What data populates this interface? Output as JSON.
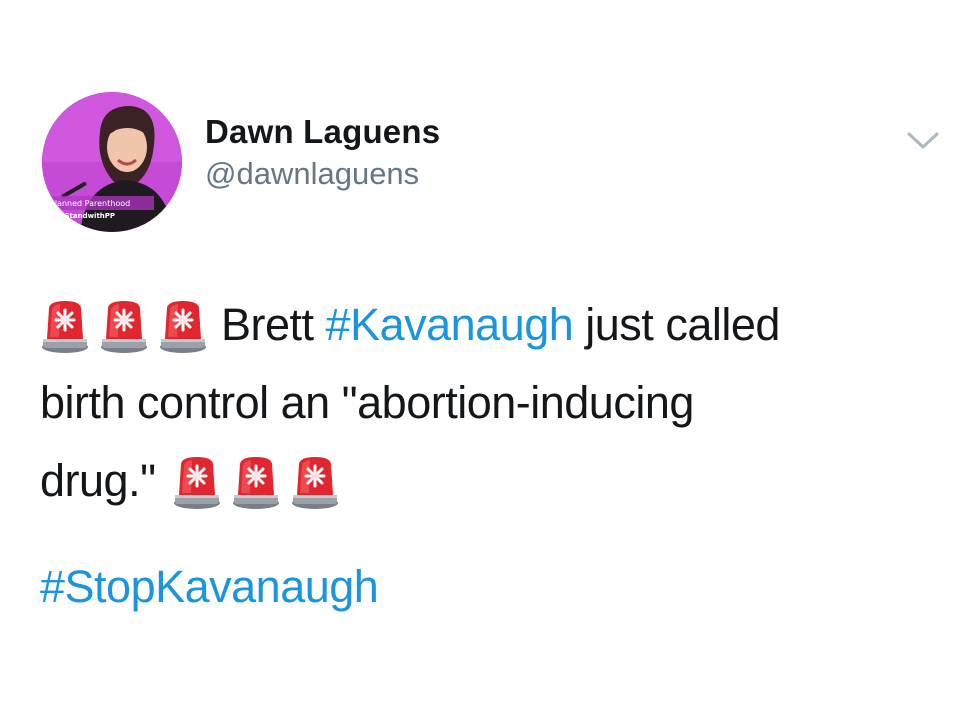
{
  "author": {
    "display_name": "Dawn Laguens",
    "handle": "@dawnlaguens",
    "avatar_caption_1": "Planned Parenthood",
    "avatar_caption_2": "#IStandwithPP"
  },
  "icons": {
    "menu_caret": "chevron-down-icon",
    "emoji": "police-car-light-icon"
  },
  "tweet": {
    "line1_text_a": "Brett ",
    "line1_hashtag": "#Kavanaugh",
    "line1_text_b": " just called",
    "line2_text": "birth control an \"abortion-inducing",
    "line3_text": "drug.\"",
    "footer_hashtag": "#StopKavanaugh"
  },
  "colors": {
    "link": "#1b95e0",
    "text": "#14171a",
    "secondary": "#657786",
    "avatar_bg": "#c54bd6"
  }
}
